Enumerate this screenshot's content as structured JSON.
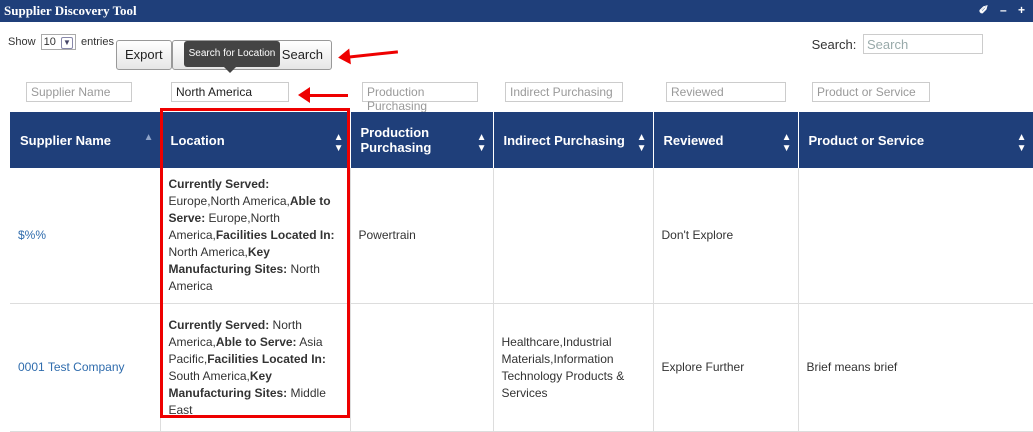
{
  "window": {
    "title": "Supplier Discovery Tool",
    "controls": " – +"
  },
  "toolbar": {
    "show_label": "Show",
    "entries_value": "10",
    "entries_label": "entries",
    "export_label": "Export",
    "search_button": "Search",
    "tooltip": "Search for Location",
    "search_label": "Search:",
    "search_placeholder": "Search"
  },
  "filters": {
    "supplier_name": "Supplier Name",
    "location_value": "North America",
    "production": "Production Purchasing",
    "indirect": "Indirect Purchasing",
    "reviewed": "Reviewed",
    "product": "Product or Service"
  },
  "columns": [
    "Supplier Name",
    "Location",
    "Production Purchasing",
    "Indirect Purchasing",
    "Reviewed",
    "Product or Service"
  ],
  "rows": [
    {
      "supplier": "$%%",
      "location": {
        "served_label": "Currently Served:",
        "served": " Europe,North America,",
        "able_label": "Able to Serve:",
        "able": " Europe,North America,",
        "facilities_label": "Facilities Located In:",
        "facilities": " North America,",
        "key_label": "Key Manufacturing Sites:",
        "key": " North America"
      },
      "production": "Powertrain",
      "indirect": "",
      "reviewed": "Don't Explore",
      "product": ""
    },
    {
      "supplier": "0001 Test Company",
      "location": {
        "served_label": "Currently Served:",
        "served": " North America,",
        "able_label": "Able to Serve:",
        "able": " Asia Pacific,",
        "facilities_label": "Facilities Located In:",
        "facilities": " South America,",
        "key_label": "Key Manufacturing Sites:",
        "key": " Middle East"
      },
      "production": "",
      "indirect": "Healthcare,Industrial Materials,Information Technology Products & Services",
      "reviewed": "Explore Further",
      "product": "Brief means brief"
    }
  ],
  "colors": {
    "header": "#1f3f7a",
    "highlight": "#e00000",
    "link": "#2f6cad"
  }
}
